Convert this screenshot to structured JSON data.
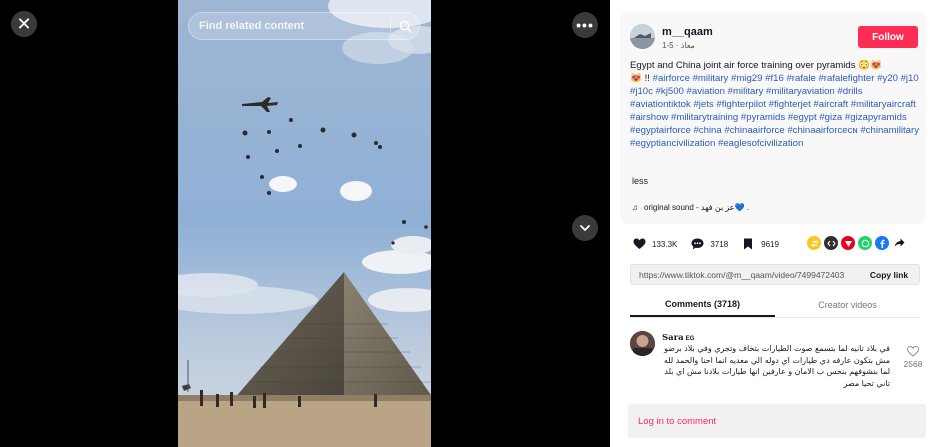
{
  "viewer": {
    "close_glyph": "✕",
    "more_glyph": "•••",
    "search": {
      "placeholder": "Find related content"
    }
  },
  "author": {
    "username": "m__qaam",
    "subline": "معاذ · 5-1"
  },
  "follow_label": "Follow",
  "description": {
    "text": "Egypt and China joint air force training over pyramids 😳😻\n😻 !! ",
    "hashtags": "#airforce #military #mig29 #f16 #rafale #rafalefighter #y20 #j10 #j10c #kj500 #aviation #military #militaryaviation #drills #aviationtiktok #jets #fighterpilot #fighterjet #aircraft #militaryaircraft #airshow #militarytraining #pyramids #egypt #giza #gizapyramids #egyptairforce #china #chinaairforce #chinaairforceᴄɴ #chinamilitary #egyptiancivilization #eaglesofcivilization"
  },
  "less_label": "less",
  "music": {
    "note_glyph": "♫",
    "label": "original sound - عز بن فهد💙 ."
  },
  "stats": {
    "likes": "133.3K",
    "comments": "3718",
    "saves": "9619"
  },
  "share_icons": [
    "repost-icon",
    "embed-icon",
    "pinterest-icon",
    "whatsapp-icon",
    "facebook-icon",
    "forward-icon"
  ],
  "colors": {
    "accent": "#fe2c55",
    "hashtag": "#2b5db9",
    "repost": "#f7c820",
    "embed": "#2f2f2f",
    "pinterest": "#e60023",
    "whatsapp": "#25d366",
    "facebook": "#1877f2"
  },
  "link": {
    "url": "https://www.tiktok.com/@m__qaam/video/7499472403",
    "copy_label": "Copy link"
  },
  "tabs": [
    {
      "label": "Comments (3718)",
      "active": true
    },
    {
      "label": "Creator videos",
      "active": false
    }
  ],
  "comment": {
    "name": "Sara",
    "flag": "EG",
    "text": "في بلاد تانيه لما بتسمع صوت الطيارات بتخاف وتجري وفي بلاد برضو مش بتكون عارفه دي طيارات اي دوله الي معديه انما احنا والحمد لله لما بنشوفهم بنحس ب الامان و عارفين انها طيارات بلادنا مش اي بلد تاني تحيا مصر",
    "likes": "2568"
  },
  "login_label": "Log in to comment"
}
